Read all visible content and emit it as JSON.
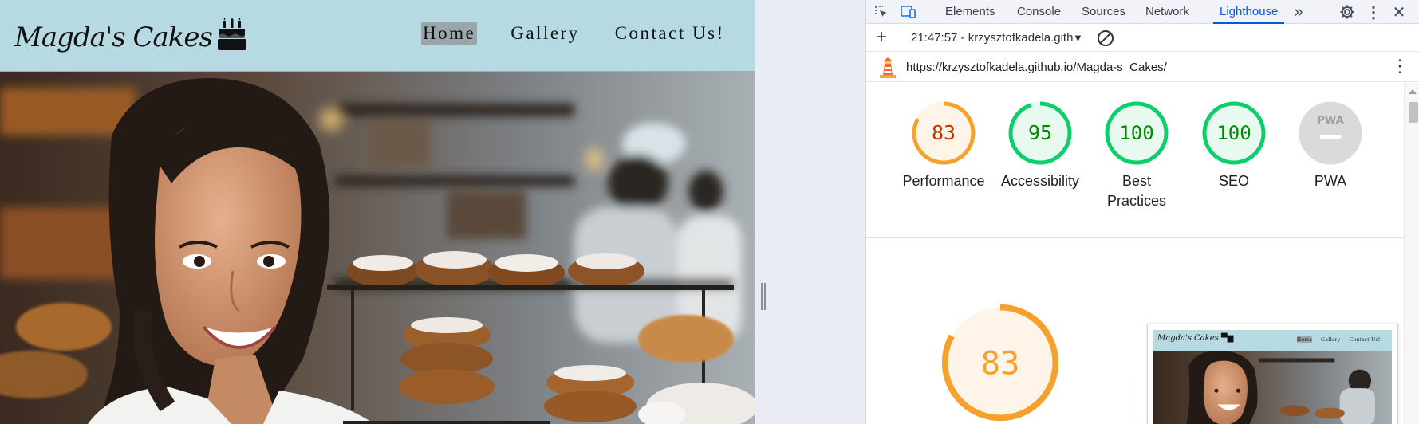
{
  "site": {
    "logo_text": "Magda's Cakes",
    "menu": [
      {
        "label": "Home",
        "active": true
      },
      {
        "label": "Gallery",
        "active": false
      },
      {
        "label": "Contact Us!",
        "active": false
      }
    ],
    "colors": {
      "nav_bg": "#b7d9e2",
      "active_bg": "#9aa6a9"
    }
  },
  "devtools": {
    "tabs": [
      "Elements",
      "Console",
      "Sources",
      "Network",
      "Lighthouse"
    ],
    "active_tab": "Lighthouse",
    "overflow_icon": "chevron-double-right-icon",
    "session_label": "21:47:57 - krzysztofkadela.gith",
    "url": "https://krzysztofkadela.github.io/Magda-s_Cakes/"
  },
  "lighthouse": {
    "scores": [
      {
        "label": "Performance",
        "value": "83",
        "score": 83,
        "color": "#f5a12c",
        "text_color": "#c33300",
        "fill": "#fff4e8"
      },
      {
        "label": "Accessibility",
        "value": "95",
        "score": 95,
        "color": "#0cce6b",
        "text_color": "#008800",
        "fill": "#e8f9ef"
      },
      {
        "label": "Best Practices",
        "value": "100",
        "score": 100,
        "color": "#0cce6b",
        "text_color": "#008800",
        "fill": "#e8f9ef"
      },
      {
        "label": "SEO",
        "value": "100",
        "score": 100,
        "color": "#0cce6b",
        "text_color": "#008800",
        "fill": "#e8f9ef"
      },
      {
        "label": "PWA",
        "value": "PWA",
        "score": null,
        "color": "#dadada",
        "text_color": "#9e9e9e",
        "fill": "#dadada"
      }
    ],
    "main_score": {
      "value": "83",
      "score": 83,
      "color": "#f5a12c",
      "text_color": "#f5a12c",
      "fill": "#fff4e8"
    }
  }
}
